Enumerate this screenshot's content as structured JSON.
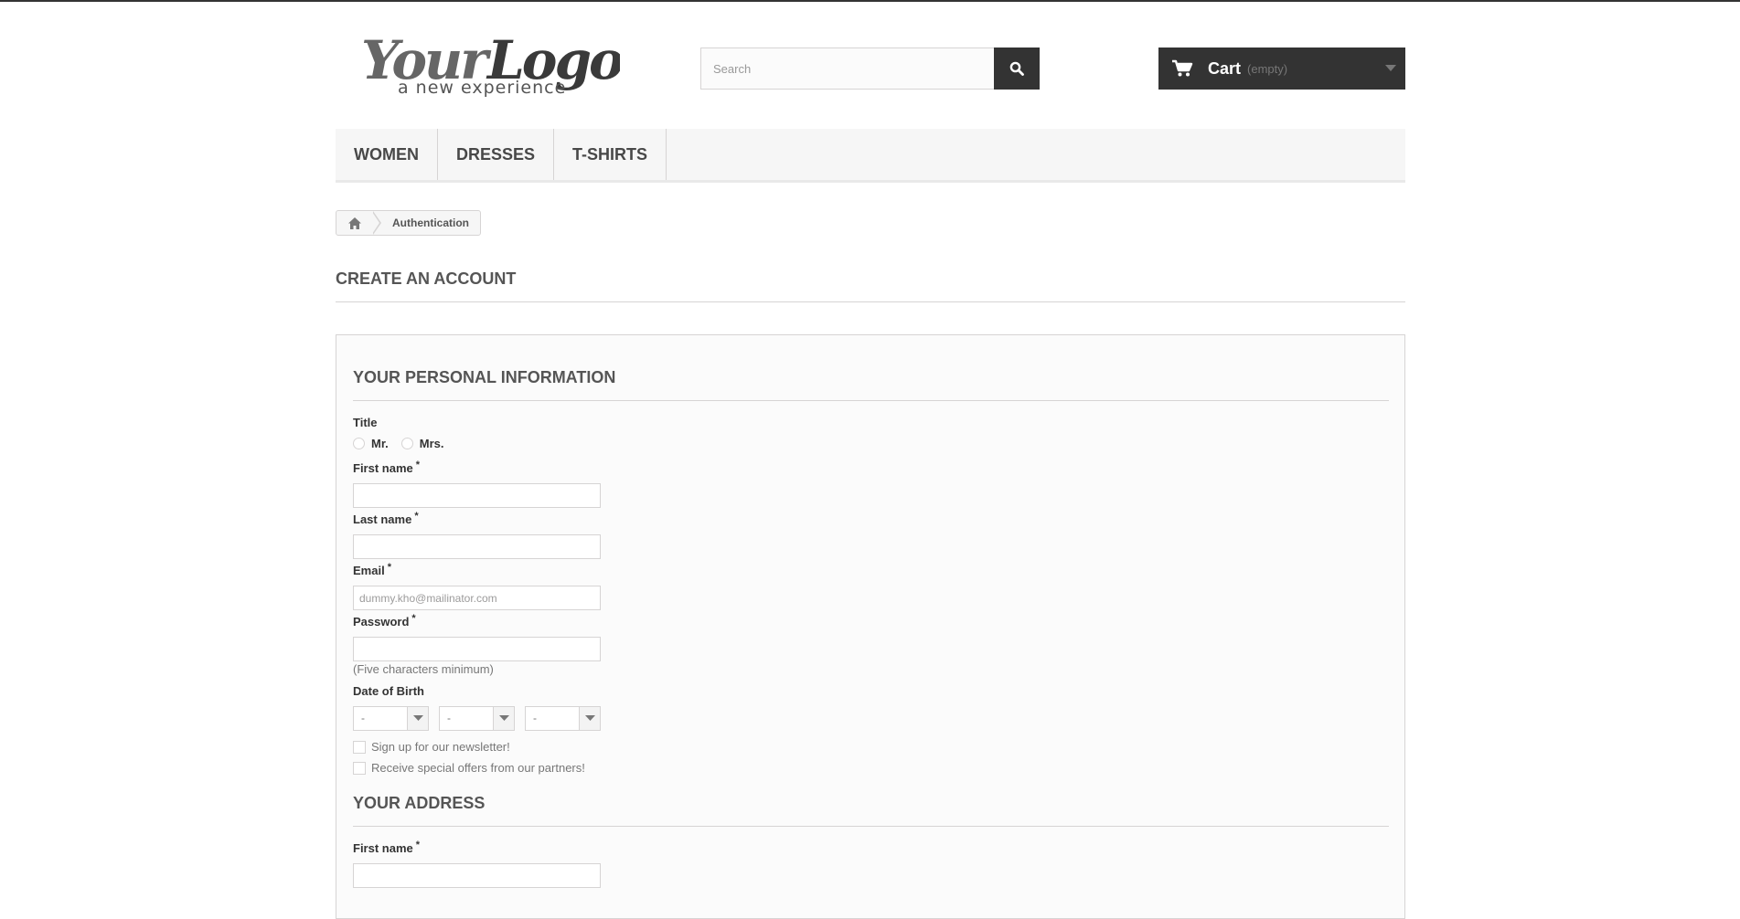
{
  "header": {
    "logo": {
      "main": "Your Logo",
      "tagline": "a new experience"
    },
    "search": {
      "placeholder": "Search"
    },
    "cart": {
      "label": "Cart",
      "status": "(empty)"
    }
  },
  "menu": {
    "items": [
      {
        "label": "WOMEN"
      },
      {
        "label": "DRESSES"
      },
      {
        "label": "T-SHIRTS"
      }
    ]
  },
  "breadcrumb": {
    "current": "Authentication"
  },
  "page": {
    "heading": "CREATE AN ACCOUNT"
  },
  "personal": {
    "heading": "YOUR PERSONAL INFORMATION",
    "title_label": "Title",
    "title_options": [
      "Mr.",
      "Mrs."
    ],
    "first_name_label": "First name",
    "last_name_label": "Last name",
    "email_label": "Email",
    "email_value": "dummy.kho@mailinator.com",
    "password_label": "Password",
    "password_hint": "(Five characters minimum)",
    "dob_label": "Date of Birth",
    "dob_day": "-",
    "dob_month": "-",
    "dob_year": "-",
    "newsletter_label": "Sign up for our newsletter!",
    "offers_label": "Receive special offers from our partners!",
    "required_marker": "*"
  },
  "address": {
    "heading": "YOUR ADDRESS",
    "first_name_label": "First name"
  }
}
